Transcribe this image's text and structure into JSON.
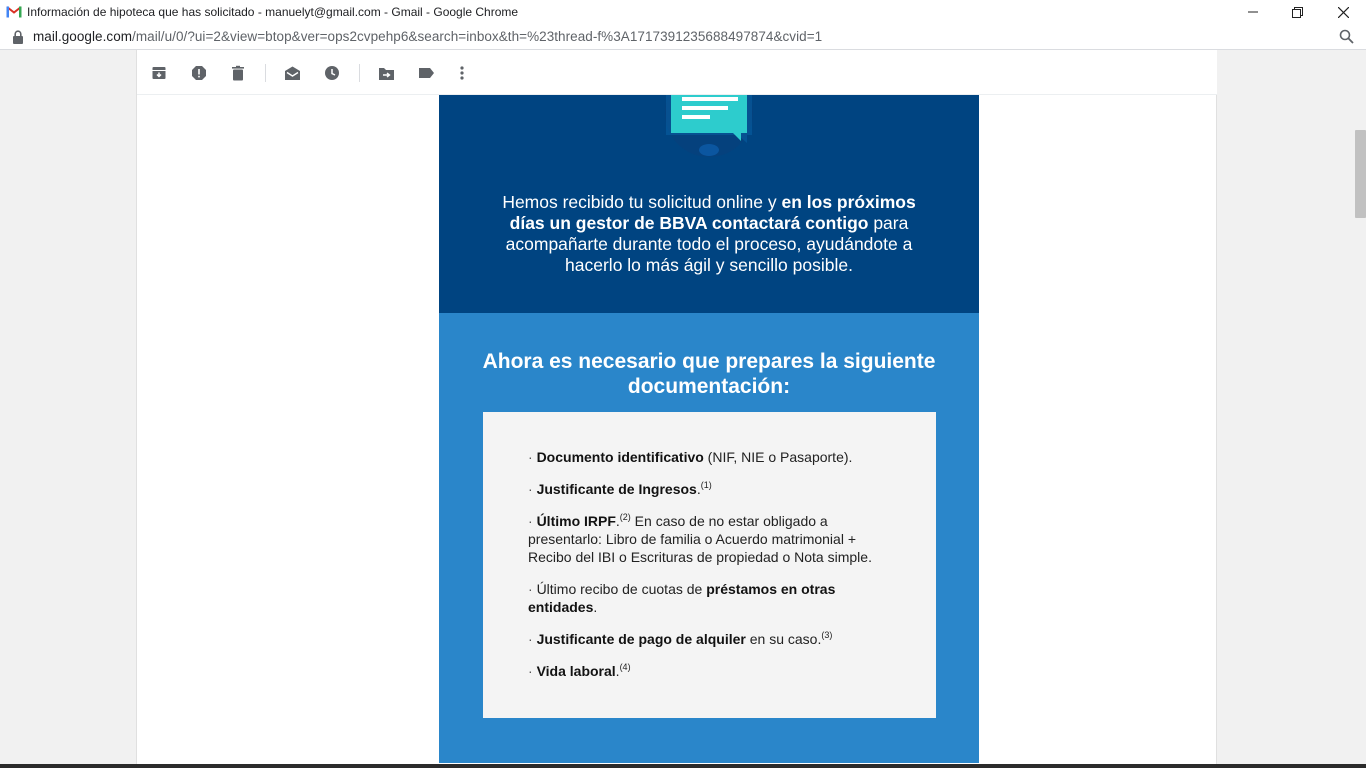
{
  "window": {
    "title": "Información de hipoteca que has solicitado - manuelyt@gmail.com - Gmail - Google Chrome",
    "url_host": "mail.google.com",
    "url_path": "/mail/u/0/?ui=2&view=btop&ver=ops2cvpehp6&search=inbox&th=%23thread-f%3A1717391235688497874&cvid=1"
  },
  "toolbar": {
    "buttons": [
      "archive-icon",
      "report-spam-icon",
      "delete-icon",
      "mark-unread-icon",
      "snooze-icon",
      "move-to-icon",
      "label-icon",
      "more-icon"
    ]
  },
  "email": {
    "hero_text_1": "Hemos recibido tu solicitud online y ",
    "hero_bold": "en los próximos días un gestor de BBVA contactará contigo",
    "hero_text_2": " para acompañarte durante todo el proceso, ayudándote a hacerlo lo más ágil y sencillo posible.",
    "docs_title": "Ahora es necesario que prepares la siguiente documentación:",
    "items": [
      {
        "bullet": "· ",
        "pre": "",
        "bold": "Documento identificativo",
        "post": " (NIF, NIE o Pasaporte).",
        "sup": ""
      },
      {
        "bullet": "· ",
        "pre": "",
        "bold": "Justificante de Ingresos",
        "post": ".",
        "sup": "(1)"
      },
      {
        "bullet": "· ",
        "pre": "",
        "bold": "Último IRPF",
        "post": ".",
        "sup": "(2)",
        "tail": " En caso de no estar obligado a presentarlo: Libro de familia o Acuerdo matrimonial + Recibo del IBI o Escrituras de propiedad o Nota simple."
      },
      {
        "bullet": "· ",
        "pre": "Último recibo de cuotas de ",
        "bold": "préstamos en otras entidades",
        "post": ".",
        "sup": ""
      },
      {
        "bullet": "· ",
        "pre": "",
        "bold": "Justificante de pago de alquiler",
        "post": " en su caso.",
        "sup": "(3)"
      },
      {
        "bullet": "· ",
        "pre": "",
        "bold": "Vida laboral",
        "post": ".",
        "sup": "(4)"
      }
    ]
  },
  "colors": {
    "hero_bg": "#004481",
    "docs_bg": "#2a86ca",
    "box_bg": "#f4f4f4",
    "icon_teal": "#2dcccd"
  }
}
